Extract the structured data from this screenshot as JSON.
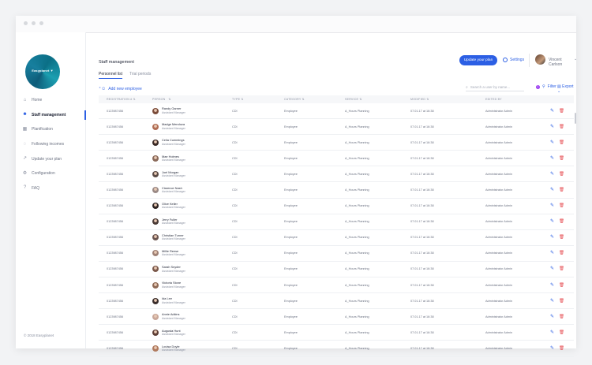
{
  "sidebar": {
    "logo_text": "Easyplanet ▼",
    "items": [
      {
        "label": "Home",
        "icon": "home-icon",
        "glyph": "⌂"
      },
      {
        "label": "Staff management",
        "icon": "users-icon",
        "glyph": "☻"
      },
      {
        "label": "Planification",
        "icon": "calendar-icon",
        "glyph": "▦"
      },
      {
        "label": "Following incomes",
        "icon": "chat-icon",
        "glyph": "◌"
      },
      {
        "label": "Update your plan",
        "icon": "trend-icon",
        "glyph": "↗"
      },
      {
        "label": "Configuration",
        "icon": "gear-icon",
        "glyph": "⚙"
      },
      {
        "label": "FAQ",
        "icon": "question-icon",
        "glyph": "?"
      }
    ],
    "copyright": "© 2018 Easyplanet"
  },
  "header": {
    "page_title": "Staff management",
    "upgrade_label": "Update your plan",
    "settings_label": "Settings",
    "user_name": "Vincent Carlson",
    "user_chevron": "⌄"
  },
  "tabs": [
    {
      "label": "Personnel list"
    },
    {
      "label": "Trial periods"
    }
  ],
  "toolbar": {
    "add_label": "Add new employee",
    "search_placeholder": "Search a user by name...",
    "filter_label": "Filter",
    "filter_count": "1",
    "export_label": "Export ⌄"
  },
  "table": {
    "headers": {
      "registration": "REGISTRATION #",
      "person": "PERSON",
      "type": "TYPE",
      "category": "CATEGORY",
      "service": "SERVICE",
      "modified": "MODIFIED",
      "edited_by": "EDITED BY"
    },
    "rows": [
      {
        "reg": "0123987456",
        "name": "Randy Garner",
        "role": "Assistant Manager",
        "type": "CDI",
        "category": "Employee",
        "service": "A_Hours Planning",
        "modified": "07.01.17 at 16:38",
        "edited_by": "Administrator Admin",
        "avatar": "#7a4b3a"
      },
      {
        "reg": "0123987456",
        "name": "Madge Mendoza",
        "role": "Assistant Manager",
        "type": "CDI",
        "category": "Employee",
        "service": "A_Hours Planning",
        "modified": "07.01.17 at 16:38",
        "edited_by": "Administrator Admin",
        "avatar": "#b06d54"
      },
      {
        "reg": "0123987456",
        "name": "Celia Cummings",
        "role": "Assistant Manager",
        "type": "CDI",
        "category": "Employee",
        "service": "A_Hours Planning",
        "modified": "07.01.17 at 16:38",
        "edited_by": "Administrator Admin",
        "avatar": "#3b2a26"
      },
      {
        "reg": "0123987456",
        "name": "Mae Holmes",
        "role": "Assistant Manager",
        "type": "CDI",
        "category": "Employee",
        "service": "A_Hours Planning",
        "modified": "07.01.17 at 16:38",
        "edited_by": "Administrator Admin",
        "avatar": "#8a6a5a"
      },
      {
        "reg": "0123987456",
        "name": "Joel Morgan",
        "role": "Assistant Manager",
        "type": "CDI",
        "category": "Employee",
        "service": "A_Hours Planning",
        "modified": "07.01.17 at 16:38",
        "edited_by": "Administrator Admin",
        "avatar": "#5a4a44"
      },
      {
        "reg": "0123987456",
        "name": "Clarence Nash",
        "role": "Assistant Manager",
        "type": "CDI",
        "category": "Employee",
        "service": "A_Hours Planning",
        "modified": "07.01.17 at 16:38",
        "edited_by": "Administrator Admin",
        "avatar": "#9a8a86"
      },
      {
        "reg": "0123987456",
        "name": "Olive Keller",
        "role": "Assistant Manager",
        "type": "CDI",
        "category": "Employee",
        "service": "A_Hours Planning",
        "modified": "07.01.17 at 16:38",
        "edited_by": "Administrator Admin",
        "avatar": "#2e2422"
      },
      {
        "reg": "0123987456",
        "name": "Jerry Fuller",
        "role": "Assistant Manager",
        "type": "CDI",
        "category": "Employee",
        "service": "A_Hours Planning",
        "modified": "07.01.17 at 16:38",
        "edited_by": "Administrator Admin",
        "avatar": "#4a3a36"
      },
      {
        "reg": "0123987456",
        "name": "Christian Turner",
        "role": "Assistant Manager",
        "type": "CDI",
        "category": "Employee",
        "service": "A_Hours Planning",
        "modified": "07.01.17 at 16:38",
        "edited_by": "Administrator Admin",
        "avatar": "#6b5550"
      },
      {
        "reg": "0123987456",
        "name": "Millie Reese",
        "role": "Assistant Manager",
        "type": "CDI",
        "category": "Employee",
        "service": "A_Hours Planning",
        "modified": "07.01.17 at 16:38",
        "edited_by": "Administrator Admin",
        "avatar": "#a08276"
      },
      {
        "reg": "0123987456",
        "name": "Sarah Snyder",
        "role": "Assistant Manager",
        "type": "CDI",
        "category": "Employee",
        "service": "A_Hours Planning",
        "modified": "07.01.17 at 16:38",
        "edited_by": "Administrator Admin",
        "avatar": "#7c5a4c"
      },
      {
        "reg": "0123987456",
        "name": "Victoria Stone",
        "role": "Assistant Manager",
        "type": "CDI",
        "category": "Employee",
        "service": "A_Hours Planning",
        "modified": "07.01.17 at 16:38",
        "edited_by": "Administrator Admin",
        "avatar": "#8e6a56"
      },
      {
        "reg": "0123987456",
        "name": "Ida Lee",
        "role": "Assistant Manager",
        "type": "CDI",
        "category": "Employee",
        "service": "A_Hours Planning",
        "modified": "07.01.17 at 16:38",
        "edited_by": "Administrator Admin",
        "avatar": "#3a2e2c"
      },
      {
        "reg": "0123987456",
        "name": "Annie Adkins",
        "role": "Assistant Manager",
        "type": "CDI",
        "category": "Employee",
        "service": "A_Hours Planning",
        "modified": "07.01.17 at 16:38",
        "edited_by": "Administrator Admin",
        "avatar": "#c9a89a"
      },
      {
        "reg": "0123987456",
        "name": "Augusta Hunt",
        "role": "Assistant Manager",
        "type": "CDI",
        "category": "Employee",
        "service": "A_Hours Planning",
        "modified": "07.01.17 at 16:38",
        "edited_by": "Administrator Admin",
        "avatar": "#5e3f36"
      },
      {
        "reg": "0123987456",
        "name": "Louisa Doyle",
        "role": "Assistant Manager",
        "type": "CDI",
        "category": "Employee",
        "service": "A_Hours Planning",
        "modified": "07.01.17 at 16:38",
        "edited_by": "Administrator Admin",
        "avatar": "#b07a5e"
      }
    ]
  }
}
